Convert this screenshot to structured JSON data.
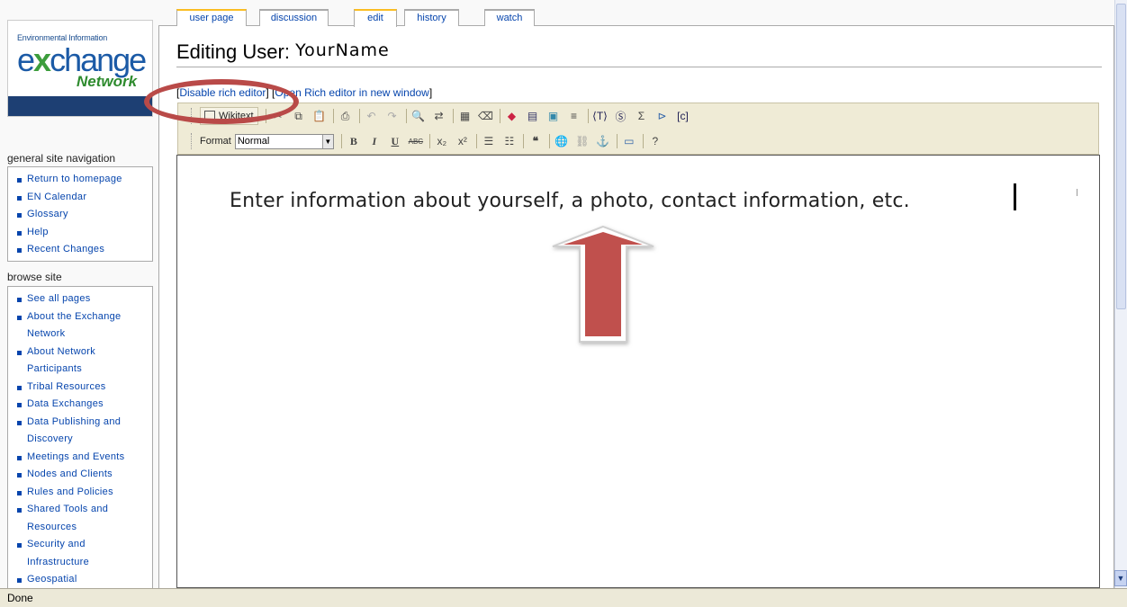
{
  "logo": {
    "top_line": "Environmental Information",
    "big_word_pre": "e",
    "big_word_x": "x",
    "big_word_post": "change",
    "network": "Network"
  },
  "nav": {
    "title": "general site navigation",
    "items": [
      "Return to homepage",
      "EN Calendar",
      "Glossary",
      "Help",
      "Recent Changes"
    ]
  },
  "browse": {
    "title": "browse site",
    "items": [
      {
        "line1": "See all pages",
        "line2": ""
      },
      {
        "line1": "About the Exchange",
        "line2": "Network"
      },
      {
        "line1": "About Network",
        "line2": "Participants"
      },
      {
        "line1": "Tribal Resources",
        "line2": ""
      },
      {
        "line1": "Data Exchanges",
        "line2": ""
      },
      {
        "line1": "Data Publishing and",
        "line2": "Discovery"
      },
      {
        "line1": "Meetings and Events",
        "line2": ""
      },
      {
        "line1": "Nodes and Clients",
        "line2": ""
      },
      {
        "line1": "Rules and Policies",
        "line2": ""
      },
      {
        "line1": "Shared Tools and",
        "line2": "Resources"
      },
      {
        "line1": "Security and",
        "line2": "Infrastructure"
      },
      {
        "line1": "Geospatial",
        "line2": ""
      }
    ]
  },
  "tabs": [
    {
      "label": "user page"
    },
    {
      "label": "discussion"
    },
    {
      "label": "edit"
    },
    {
      "label": "history"
    },
    {
      "label": "watch"
    }
  ],
  "page": {
    "title_prefix": "Editing User: ",
    "title_name": "YourName"
  },
  "editor_links": {
    "disable": "Disable rich editor",
    "open": "Open Rich editor in new window"
  },
  "toolbar": {
    "wikitext_label": "Wikitext",
    "format_label": "Format",
    "format_value": "Normal"
  },
  "editor": {
    "content": "Enter information about yourself, a photo, contact information, etc."
  },
  "status": {
    "text": "Done"
  },
  "colors": {
    "annotation": "#b94a48",
    "link": "#0645ad",
    "tab_accent": "#fabd23"
  }
}
